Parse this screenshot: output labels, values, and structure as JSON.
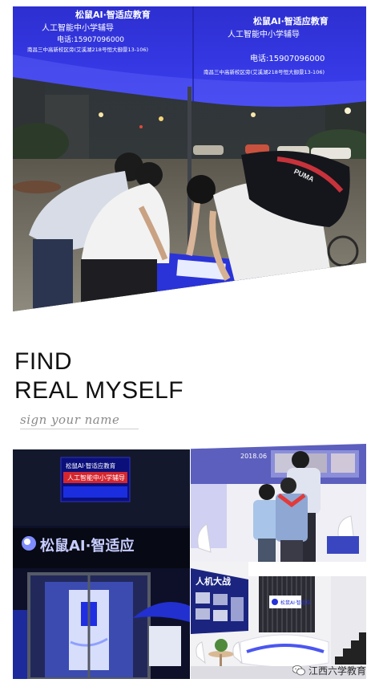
{
  "umbrella": {
    "brand_left": "松鼠AI·智适应教育",
    "tagline": "人工智能中小学辅导",
    "phone": "电话:15907096000",
    "address": "南昌三中高新校区旁(艾溪湖218号恒大御景13-106)"
  },
  "headline": {
    "line1": "FIND",
    "line2": "REAL MYSELF",
    "signature": "sign your name"
  },
  "store": {
    "screen_line1": "松鼠AI·智适应教育",
    "screen_line2": "人工智能中小学辅导",
    "sign": "松鼠AI·智适应"
  },
  "classroom": {
    "banner": "2018.06"
  },
  "lobby": {
    "wall_title": "人机大战",
    "reception_logo": "松鼠AI·智适应"
  },
  "watermark": {
    "text": "江西六学教育",
    "icon": "wechat-icon"
  }
}
